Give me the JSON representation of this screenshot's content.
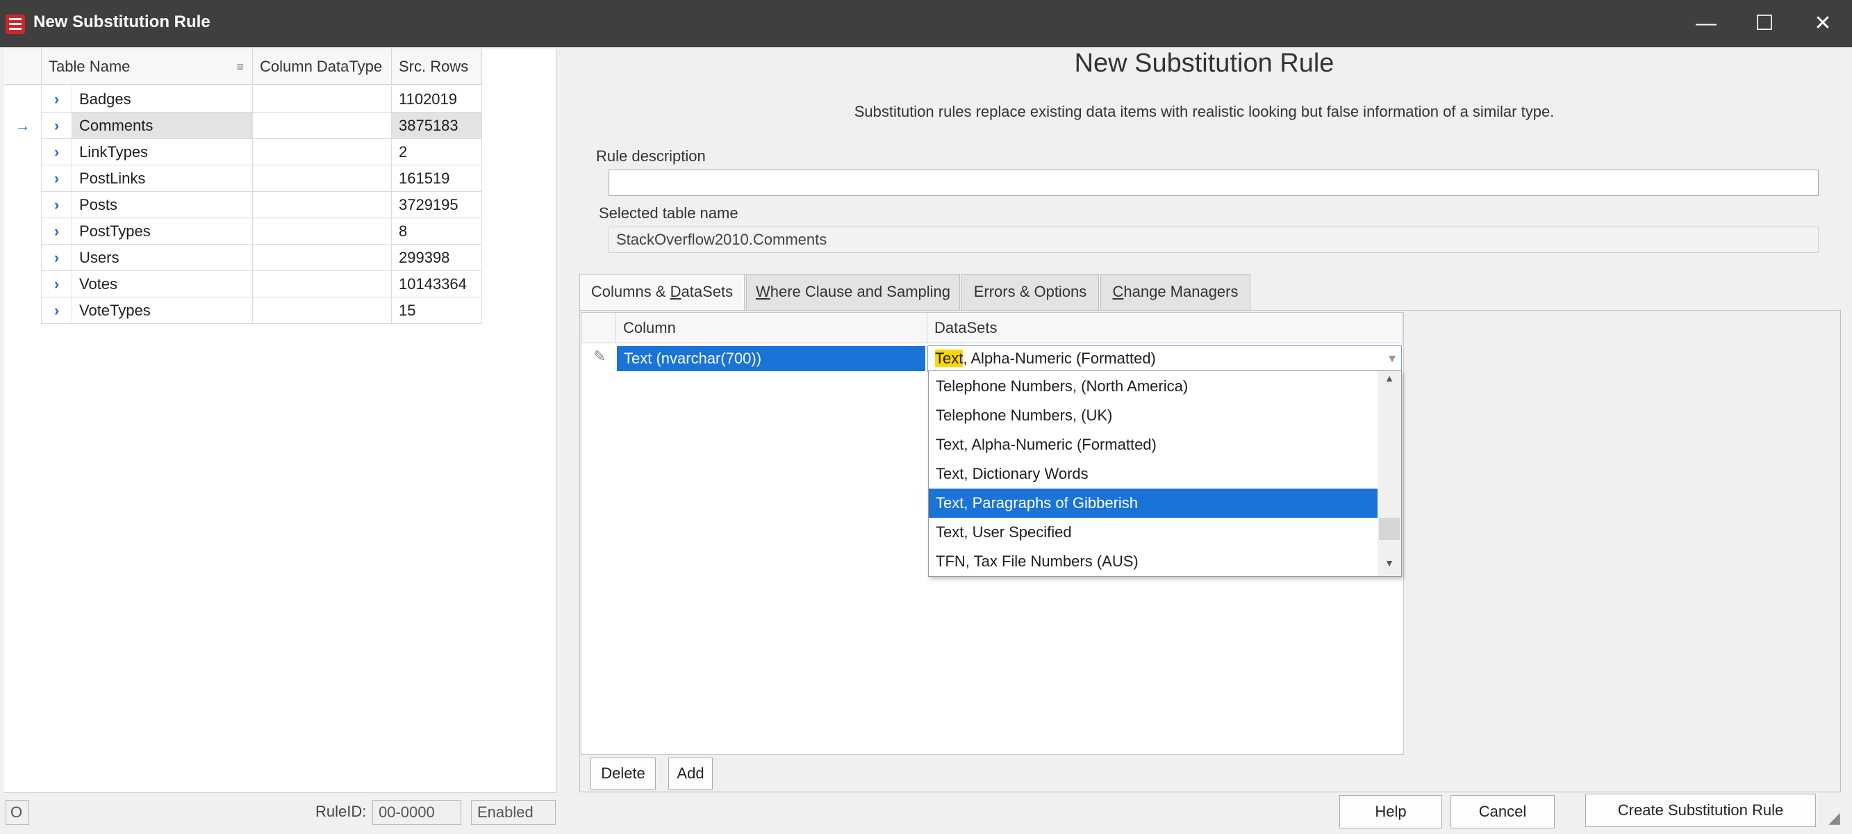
{
  "window": {
    "title": "New Substitution Rule",
    "controls": {
      "minimize": "—",
      "maximize": "☐",
      "close": "✕"
    }
  },
  "table_grid": {
    "columns": [
      "Table Name",
      "Column DataType",
      "Src. Rows"
    ],
    "rows": [
      {
        "name": "Badges",
        "datatype": "",
        "rows": "1102019"
      },
      {
        "name": "Comments",
        "datatype": "",
        "rows": "3875183",
        "current": true
      },
      {
        "name": "LinkTypes",
        "datatype": "",
        "rows": "2"
      },
      {
        "name": "PostLinks",
        "datatype": "",
        "rows": "161519"
      },
      {
        "name": "Posts",
        "datatype": "",
        "rows": "3729195"
      },
      {
        "name": "PostTypes",
        "datatype": "",
        "rows": "8"
      },
      {
        "name": "Users",
        "datatype": "",
        "rows": "299398"
      },
      {
        "name": "Votes",
        "datatype": "",
        "rows": "10143364"
      },
      {
        "name": "VoteTypes",
        "datatype": "",
        "rows": "15"
      }
    ],
    "current_row_marker": "→",
    "expand_glyph": "›"
  },
  "left_footer": {
    "o_label": "O",
    "ruleid_label": "RuleID:",
    "ruleid_value": "00-0000",
    "status": "Enabled"
  },
  "main": {
    "heading": "New Substitution Rule",
    "description": "Substitution rules replace existing data items with realistic looking but false information of a similar type.",
    "rule_description_label": "Rule description",
    "rule_description_value": "",
    "selected_table_label": "Selected table name",
    "selected_table_value": "StackOverflow2010.Comments"
  },
  "tabs": [
    {
      "pre": "Columns & ",
      "u": "D",
      "post": "ataSets",
      "active": true
    },
    {
      "pre": "",
      "u": "W",
      "post": "here Clause and Sampling",
      "active": false
    },
    {
      "pre": "Errors & Options",
      "u": "",
      "post": "",
      "active": false
    },
    {
      "pre": "",
      "u": "C",
      "post": "hange Managers",
      "active": false
    }
  ],
  "columns_grid": {
    "headers": [
      "Column",
      "DataSets"
    ],
    "edit_icon": "✎",
    "column_value": "Text  (nvarchar(700))",
    "dataset_highlight": "Text",
    "dataset_rest": ", Alpha-Numeric (Formatted)",
    "dropdown_arrow": "▾"
  },
  "dropdown": {
    "items": [
      "Telephone Numbers, (North America)",
      "Telephone Numbers, (UK)",
      "Text, Alpha-Numeric (Formatted)",
      "Text, Dictionary Words",
      "Text, Paragraphs of Gibberish",
      "Text, User Specified",
      "TFN, Tax File Numbers (AUS)"
    ],
    "selected_index": 4,
    "scroll_up": "▲",
    "scroll_down": "▼"
  },
  "buttons": {
    "delete": "Delete",
    "add": "Add",
    "help": "Help",
    "cancel": "Cancel",
    "create": "Create Substitution Rule"
  },
  "colors": {
    "titlebar": "#3f3f3f",
    "selection": "#1a73d6",
    "highlight": "#ffd700",
    "brand": "#c9282d"
  }
}
